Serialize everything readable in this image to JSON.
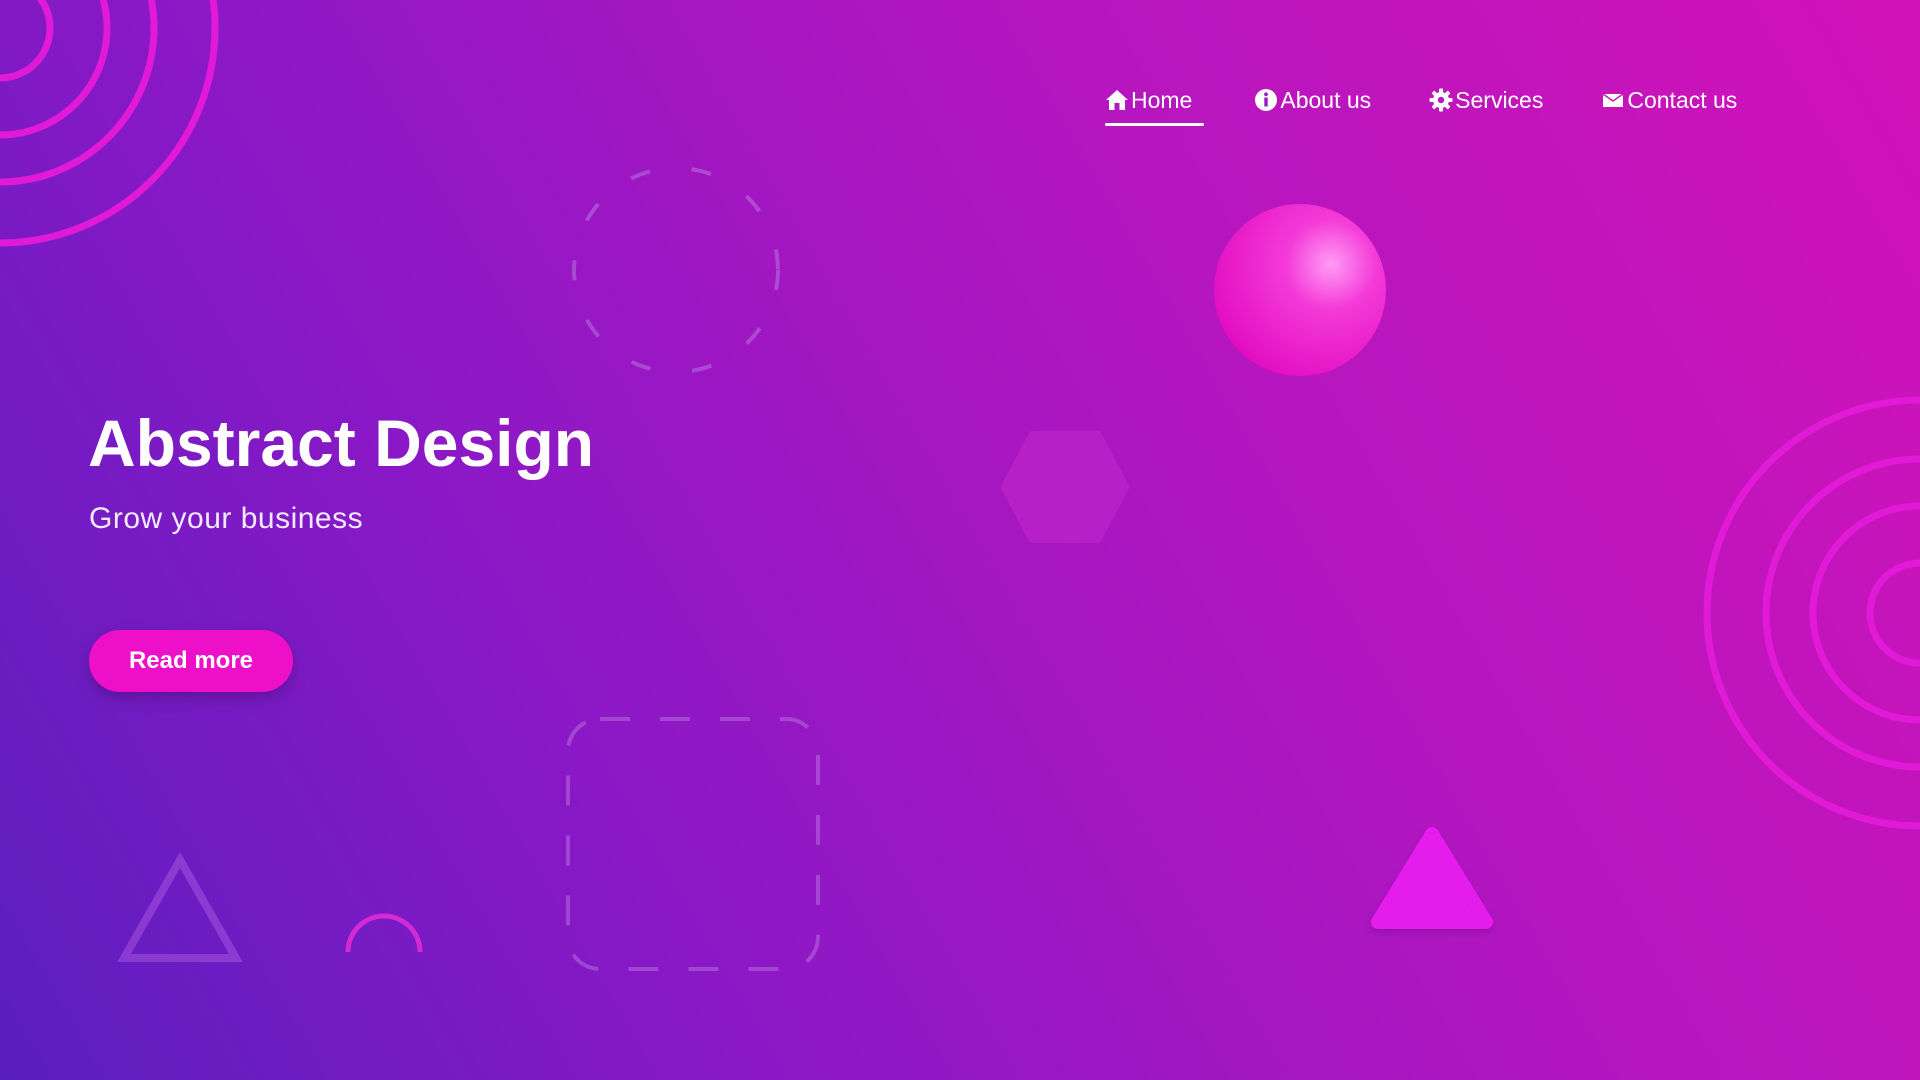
{
  "nav": {
    "items": [
      {
        "label": "Home",
        "icon": "home-icon",
        "active": true
      },
      {
        "label": "About us",
        "icon": "info-icon",
        "active": false
      },
      {
        "label": "Services",
        "icon": "gear-icon",
        "active": false
      },
      {
        "label": "Contact us",
        "icon": "envelope-icon",
        "active": false
      }
    ]
  },
  "hero": {
    "title": "Abstract Design",
    "subtitle": "Grow your business",
    "button_label": "Read more"
  },
  "colors": {
    "background_start": "#5a1fbf",
    "background_end": "#d212b8",
    "accent_pink": "#ee10c8",
    "ring_magenta": "#e01ad6",
    "text": "#ffffff"
  }
}
